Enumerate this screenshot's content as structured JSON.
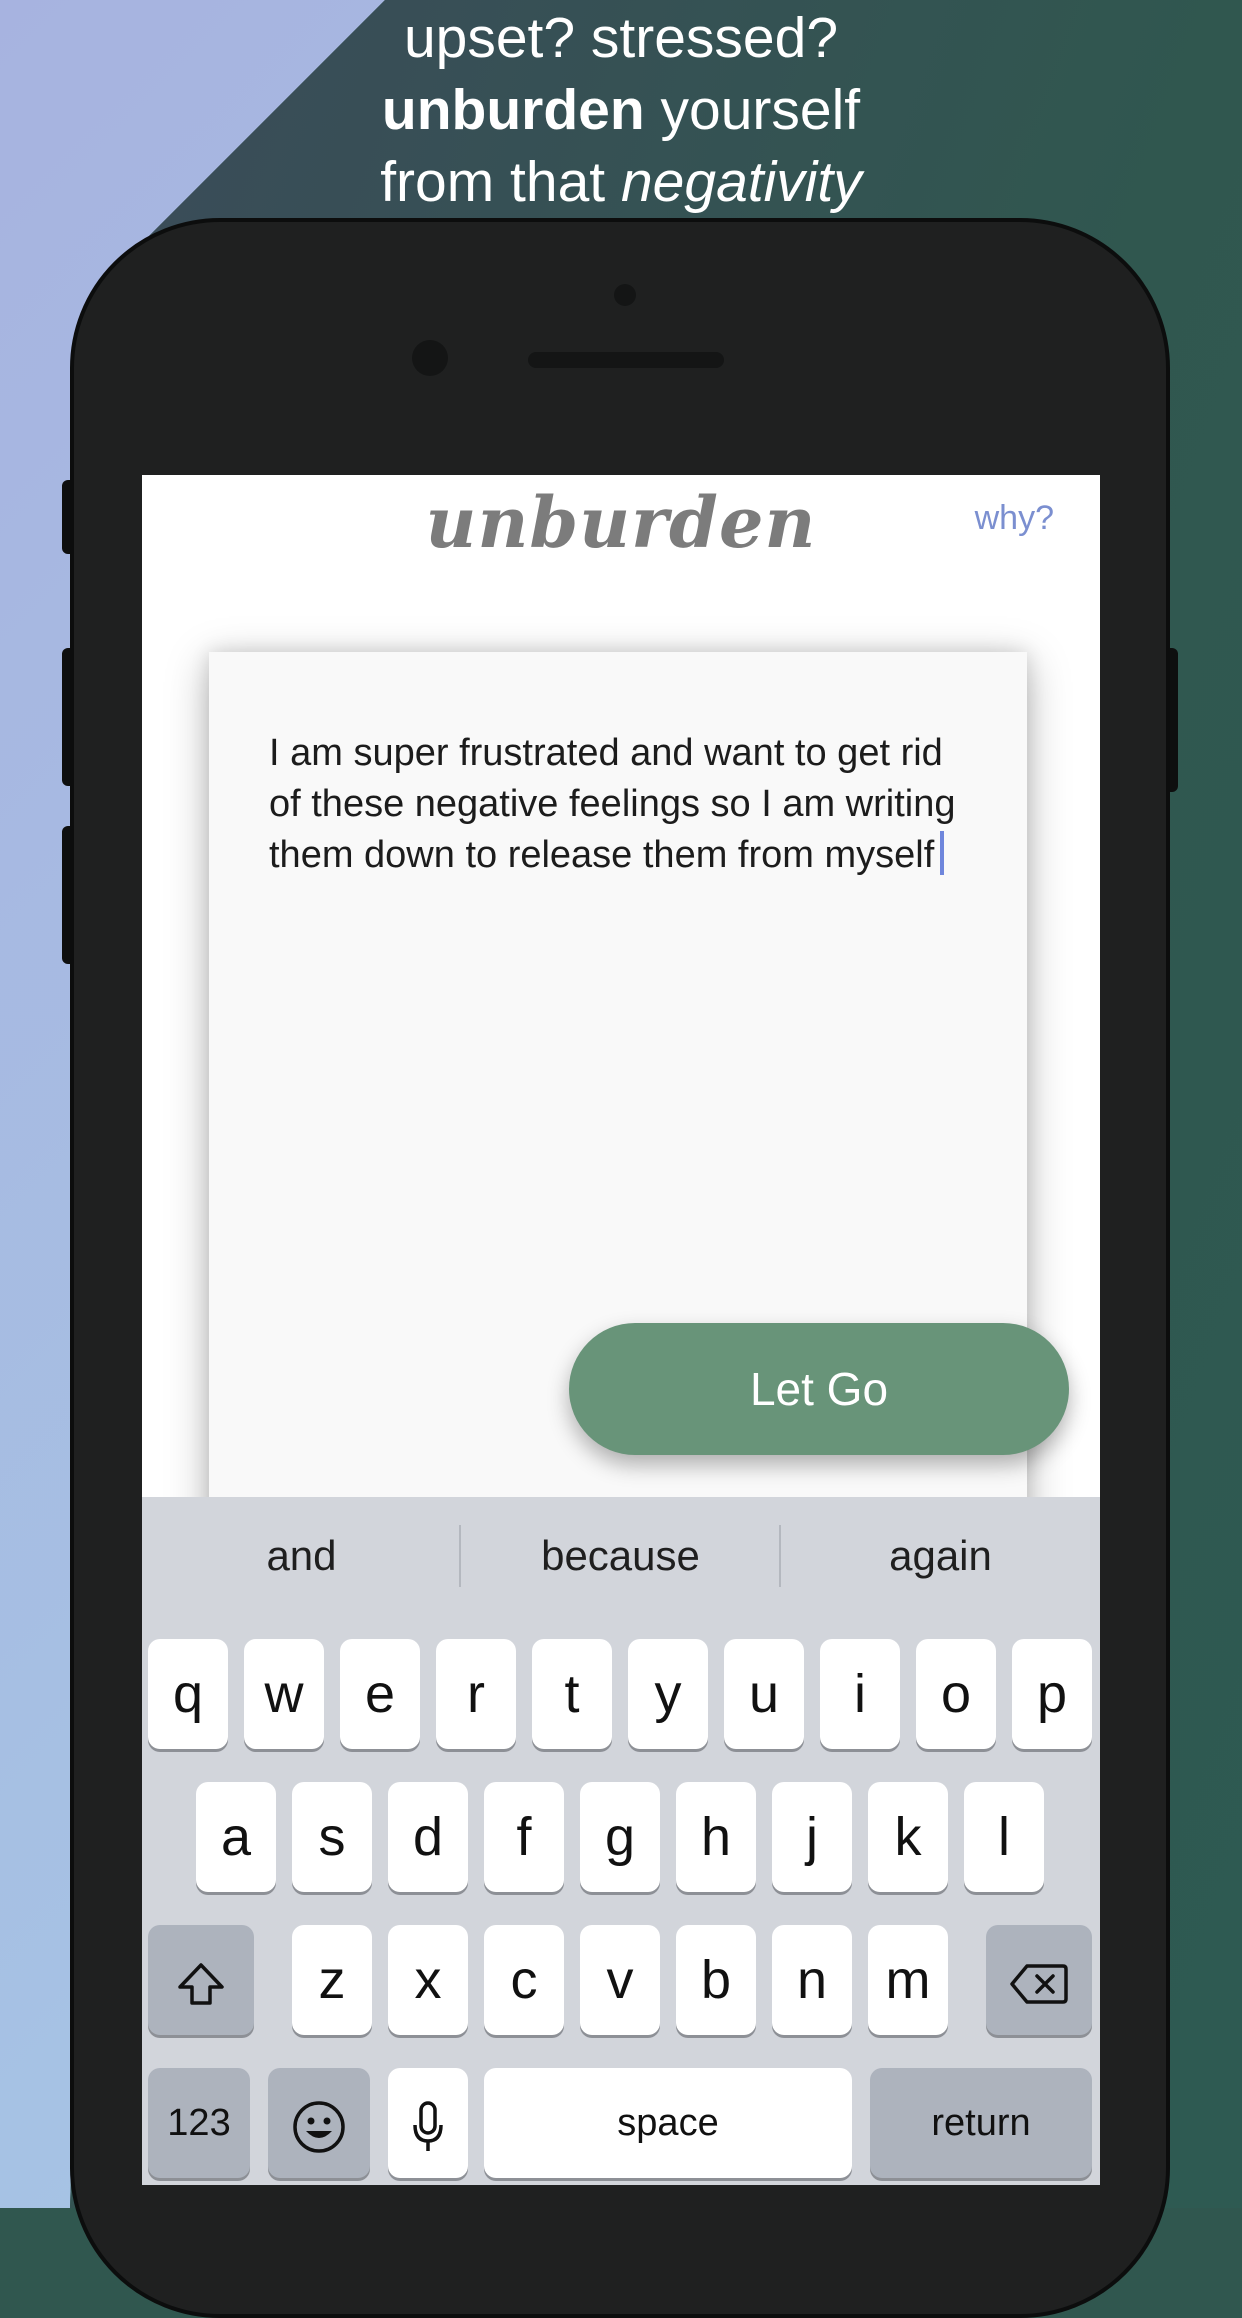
{
  "promo": {
    "line1": "upset? stressed?",
    "line2_bold": "unburden",
    "line2_rest": " yourself",
    "line3_start": "from that ",
    "line3_italic": "negativity"
  },
  "app": {
    "logo": "unburden",
    "why_link": "why?",
    "entry_text": "I am super frustrated and want to get rid of these negative feelings so I am writing them down to release them from myself",
    "let_go_button": "Let Go"
  },
  "keyboard": {
    "suggestions": [
      "and",
      "because",
      "again"
    ],
    "row1": [
      "q",
      "w",
      "e",
      "r",
      "t",
      "y",
      "u",
      "i",
      "o",
      "p"
    ],
    "row2": [
      "a",
      "s",
      "d",
      "f",
      "g",
      "h",
      "j",
      "k",
      "l"
    ],
    "row3": [
      "z",
      "x",
      "c",
      "v",
      "b",
      "n",
      "m"
    ],
    "numbers_key": "123",
    "space_key": "space",
    "return_key": "return",
    "icons": [
      "shift-icon",
      "delete-icon",
      "emoji-icon",
      "microphone-icon"
    ]
  },
  "colors": {
    "accent_green": "#689479",
    "link_blue": "#7b8fd0",
    "background_teal": "#30574f",
    "background_lavender": "#a7b3e0"
  }
}
